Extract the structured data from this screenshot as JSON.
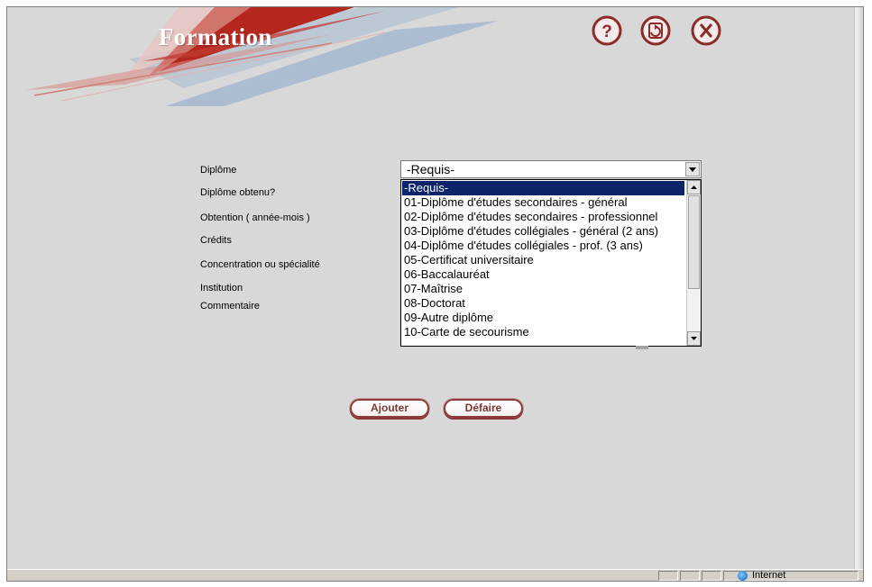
{
  "page": {
    "title": "Formation"
  },
  "header_icons": [
    {
      "name": "help-icon",
      "glyph": "?"
    },
    {
      "name": "refresh-icon",
      "glyph": "↻"
    },
    {
      "name": "close-icon",
      "glyph": "X"
    }
  ],
  "form": {
    "labels": {
      "diplome": "Diplôme",
      "diplome_obtenu": "Diplôme obtenu?",
      "obtention": "Obtention ( année-mois )",
      "credits": "Crédits",
      "concentration": "Concentration ou spécialité",
      "institution": "Institution",
      "commentaire": "Commentaire"
    },
    "diplome_select": {
      "value": "-Requis-",
      "options": [
        "-Requis-",
        "01-Diplôme d'études secondaires - général",
        "02-Diplôme d'études secondaires - professionnel",
        "03-Diplôme d'études collégiales - général (2 ans)",
        "04-Diplôme d'études collégiales - prof. (3 ans)",
        "05-Certificat universitaire",
        "06-Baccalauréat",
        "07-Maîtrise",
        "08-Doctorat",
        "09-Autre diplôme",
        "10-Carte de secourisme"
      ],
      "highlighted_index": 0
    },
    "buttons": {
      "ajouter": "Ajouter",
      "defaire": "Défaire"
    }
  },
  "statusbar": {
    "zone": "Internet"
  },
  "colors": {
    "background": "#d8d8d8",
    "title_text": "#ffffff",
    "banner_red": "#b5261f",
    "banner_blue": "#9fb4cf",
    "button_border": "#8d3a39",
    "button_text": "#7c3939",
    "selection": "#0b246a"
  }
}
